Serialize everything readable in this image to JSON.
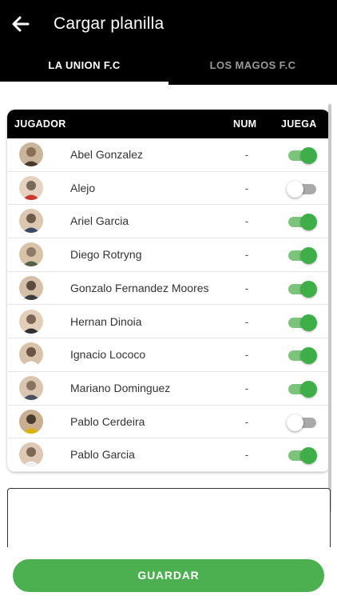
{
  "header": {
    "title": "Cargar planilla"
  },
  "tabs": [
    {
      "label": "LA UNION F.C",
      "active": true
    },
    {
      "label": "LOS MAGOS F.C",
      "active": false
    }
  ],
  "table": {
    "columns": {
      "player": "JUGADOR",
      "num": "NUM",
      "plays": "JUEGA"
    },
    "rows": [
      {
        "name": "Abel Gonzalez",
        "num": "-",
        "plays": true
      },
      {
        "name": "Alejo",
        "num": "-",
        "plays": false
      },
      {
        "name": "Ariel Garcia",
        "num": "-",
        "plays": true
      },
      {
        "name": "Diego Rotryng",
        "num": "-",
        "plays": true
      },
      {
        "name": "Gonzalo Fernandez Moores",
        "num": "-",
        "plays": true
      },
      {
        "name": "Hernan Dinoia",
        "num": "-",
        "plays": true
      },
      {
        "name": "Ignacio Lococo",
        "num": "-",
        "plays": true
      },
      {
        "name": "Mariano Dominguez",
        "num": "-",
        "plays": true
      },
      {
        "name": "Pablo Cerdeira",
        "num": "-",
        "plays": false
      },
      {
        "name": "Pablo Garcia",
        "num": "-",
        "plays": true
      }
    ]
  },
  "footer": {
    "save_label": "GUARDAR"
  },
  "colors": {
    "header_bg": "#000000",
    "accent_green": "#4caf50",
    "toggle_on": "#3fae49",
    "toggle_off": "#a9a9a9"
  }
}
